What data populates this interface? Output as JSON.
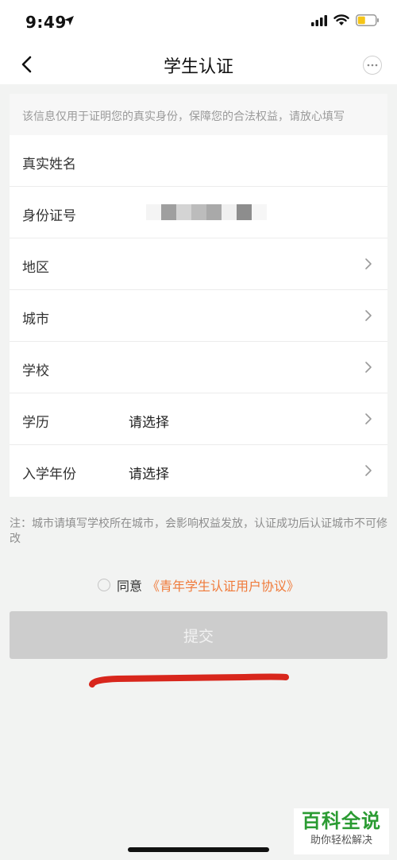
{
  "status_bar": {
    "time": "9:49",
    "icons": [
      "location-arrow-icon",
      "signal-icon",
      "wifi-icon",
      "battery-icon"
    ],
    "battery_color": "#f5c518"
  },
  "nav": {
    "back_icon": "chevron-left-icon",
    "title": "学生认证",
    "more_icon": "more-dots-icon"
  },
  "notice": "该信息仅用于证明您的真实身份，保障您的合法权益，请放心填写",
  "form": {
    "rows": [
      {
        "label": "真实姓名",
        "value": "",
        "chevron": false
      },
      {
        "label": "身份证号",
        "value": "",
        "chevron": false,
        "masked": true
      },
      {
        "label": "地区",
        "value": "",
        "chevron": true
      },
      {
        "label": "城市",
        "value": "",
        "chevron": true
      },
      {
        "label": "学校",
        "value": "",
        "chevron": true
      },
      {
        "label": "学历",
        "value": "请选择",
        "chevron": true
      },
      {
        "label": "入学年份",
        "value": "请选择",
        "chevron": true
      }
    ]
  },
  "footnote": "注：城市请填写学校所在城市，会影响权益发放，认证成功后认证城市不可修改",
  "agreement": {
    "text": "同意",
    "link": "《青年学生认证用户协议》",
    "link_color": "#f07a3a"
  },
  "submit": {
    "label": "提交",
    "bg_color": "#cdcdcd"
  },
  "watermark": {
    "title": "百科全说",
    "subtitle": "助你轻松解决",
    "color": "#2a9b32"
  }
}
